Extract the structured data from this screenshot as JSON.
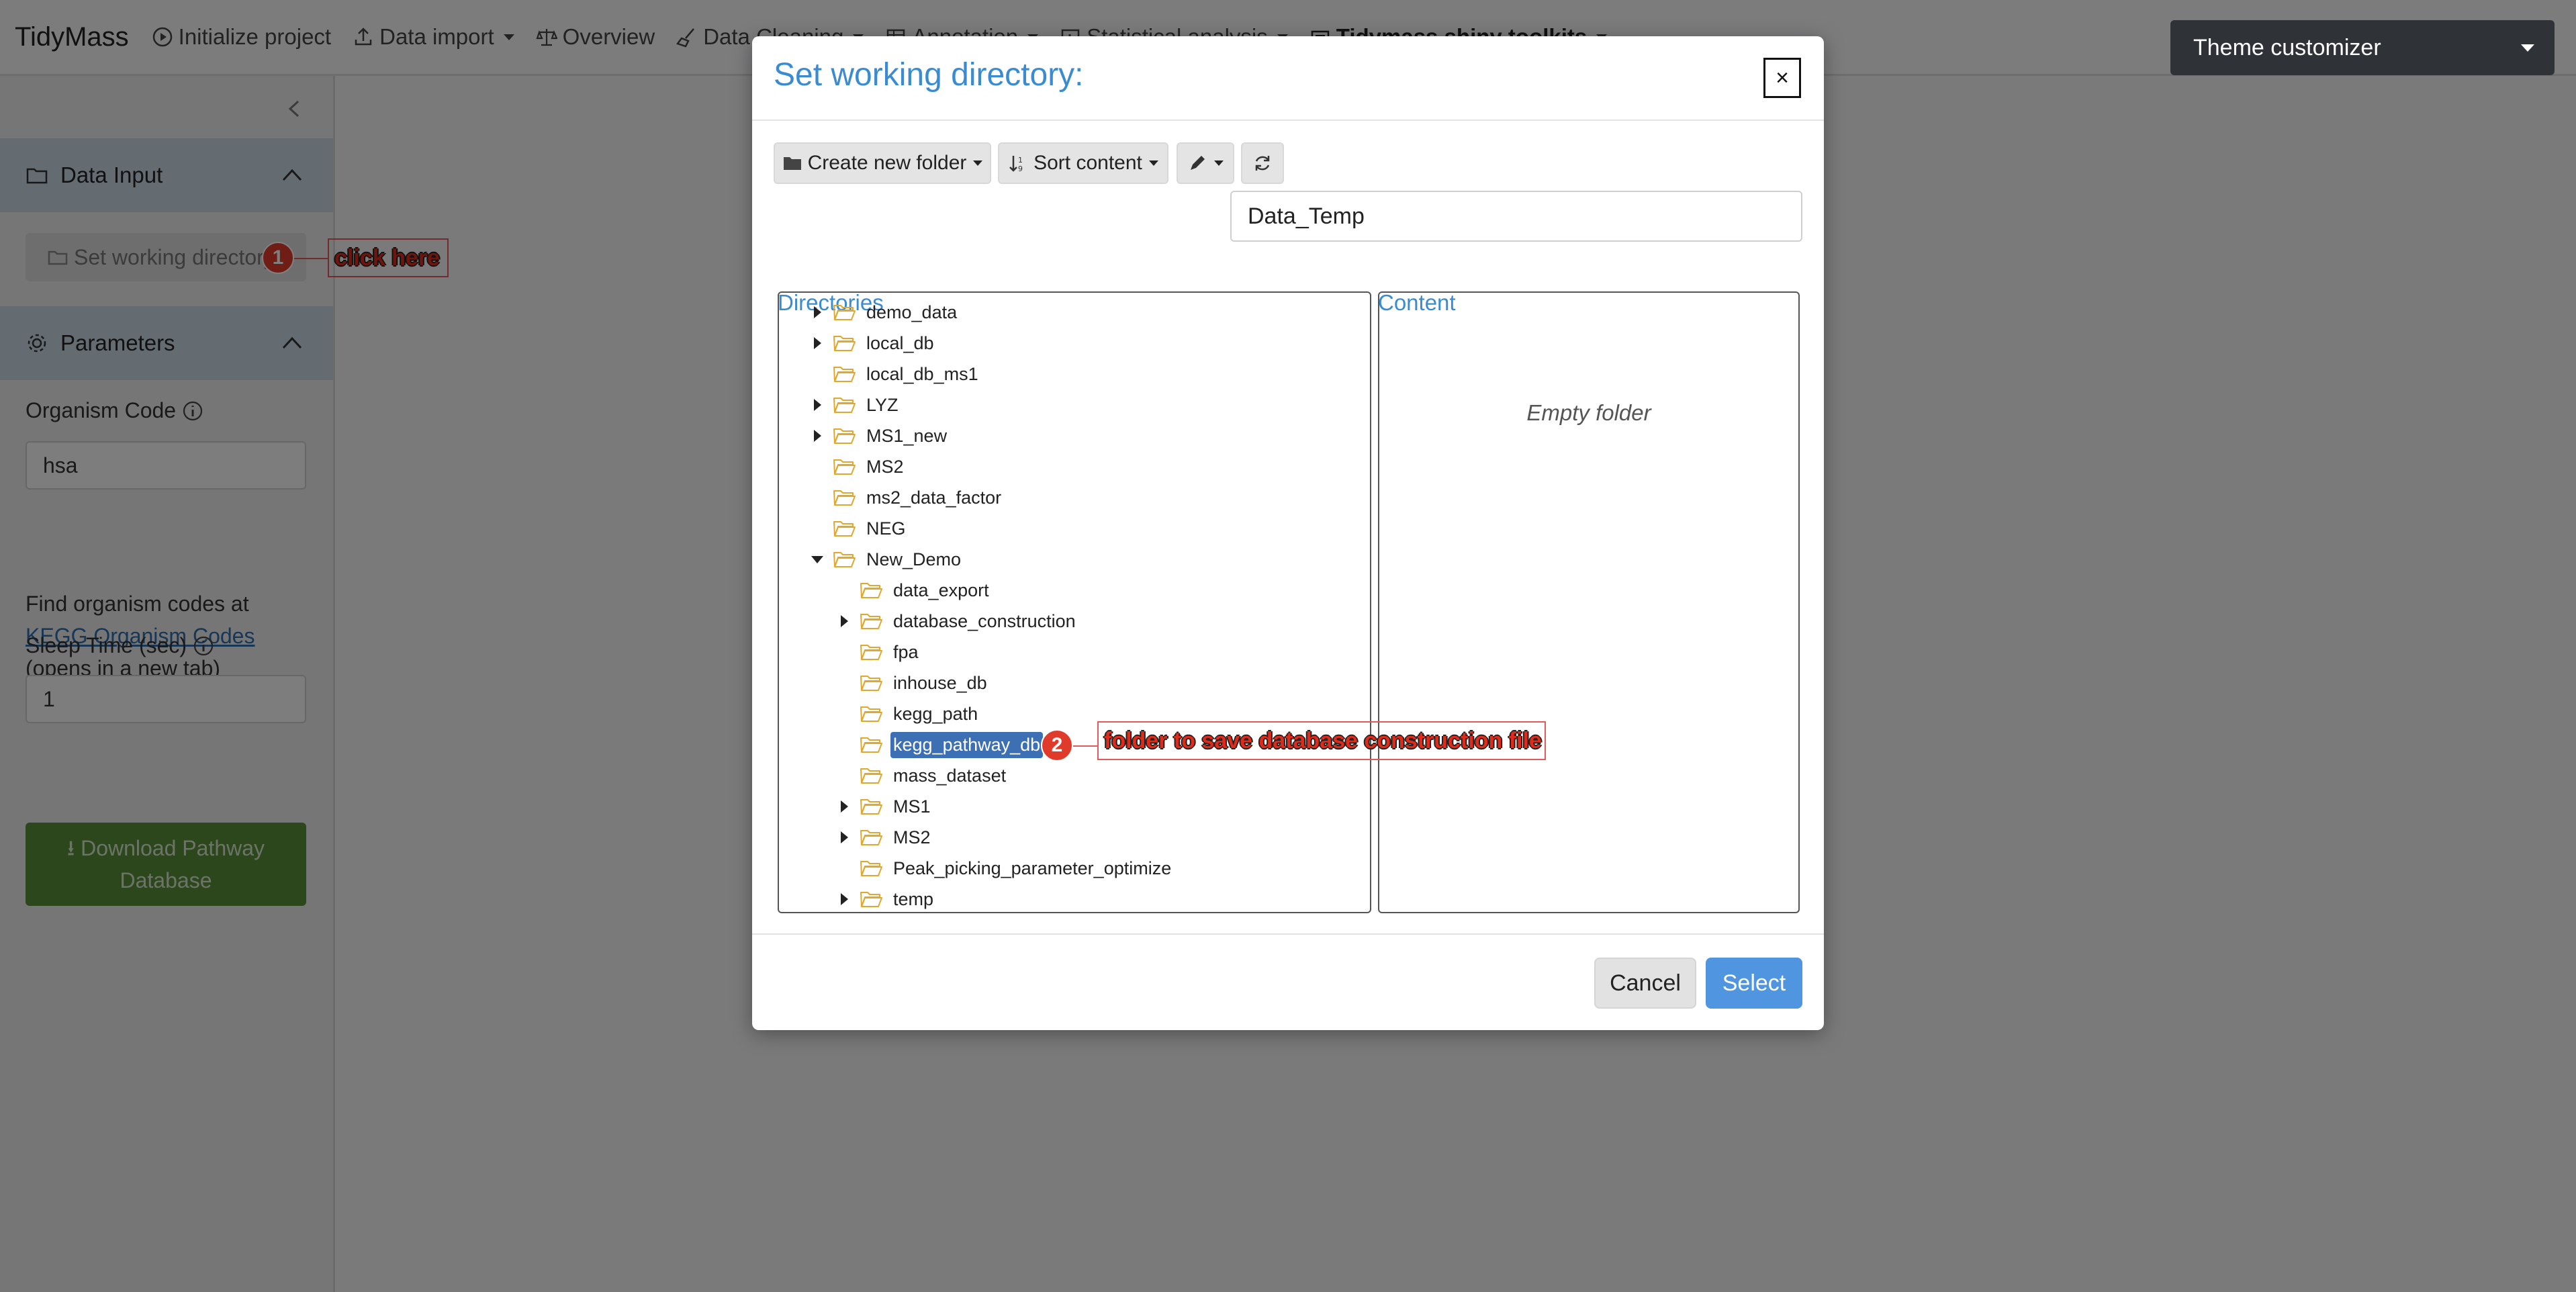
{
  "navbar": {
    "brand": "TidyMass",
    "items": [
      {
        "label": "Initialize project",
        "icon": "play-circle-icon",
        "dropdown": false
      },
      {
        "label": "Data import",
        "icon": "upload-icon",
        "dropdown": true
      },
      {
        "label": "Overview",
        "icon": "balance-scale-icon",
        "dropdown": false
      },
      {
        "label": "Data Cleaning",
        "icon": "broom-icon",
        "dropdown": true
      },
      {
        "label": "Annotation",
        "icon": "table-icon",
        "dropdown": true
      },
      {
        "label": "Statistical analysis",
        "icon": "chart-icon",
        "dropdown": true
      },
      {
        "label": "Tidymass shiny toolkits",
        "icon": "toolbox-icon",
        "dropdown": true
      }
    ]
  },
  "theme_customizer": {
    "label": "Theme customizer"
  },
  "sidebar": {
    "data_input": {
      "title": "Data Input",
      "set_wd_label": "Set working directory"
    },
    "parameters": {
      "title": "Parameters",
      "organism_label": "Organism Code",
      "organism_value": "hsa",
      "helper_prefix": "Find organism codes at",
      "helper_link": "KEGG Organism Codes",
      "helper_suffix": "(opens in a new tab)",
      "sleep_label": "Sleep Time (sec)",
      "sleep_value": "1",
      "download_label": "Download Pathway Database"
    }
  },
  "annotations": [
    {
      "number": "1",
      "text": "click here"
    },
    {
      "number": "2",
      "text": "folder to save database construction file"
    }
  ],
  "modal": {
    "title": "Set working directory:",
    "close_label": "×",
    "toolbar": {
      "create_folder": "Create new folder",
      "sort_content": "Sort content"
    },
    "path_value": "Data_Temp",
    "directories_label": "Directories",
    "content_label": "Content",
    "empty_text": "Empty folder",
    "tree": [
      {
        "name": "demo_data",
        "depth": 0,
        "expander": "collapsed"
      },
      {
        "name": "local_db",
        "depth": 0,
        "expander": "collapsed"
      },
      {
        "name": "local_db_ms1",
        "depth": 0,
        "expander": "none"
      },
      {
        "name": "LYZ",
        "depth": 0,
        "expander": "collapsed"
      },
      {
        "name": "MS1_new",
        "depth": 0,
        "expander": "collapsed"
      },
      {
        "name": "MS2",
        "depth": 0,
        "expander": "none"
      },
      {
        "name": "ms2_data_factor",
        "depth": 0,
        "expander": "none"
      },
      {
        "name": "NEG",
        "depth": 0,
        "expander": "none"
      },
      {
        "name": "New_Demo",
        "depth": 0,
        "expander": "expanded"
      },
      {
        "name": "data_export",
        "depth": 1,
        "expander": "none"
      },
      {
        "name": "database_construction",
        "depth": 1,
        "expander": "collapsed"
      },
      {
        "name": "fpa",
        "depth": 1,
        "expander": "none"
      },
      {
        "name": "inhouse_db",
        "depth": 1,
        "expander": "none"
      },
      {
        "name": "kegg_path",
        "depth": 1,
        "expander": "none"
      },
      {
        "name": "kegg_pathway_db",
        "depth": 1,
        "expander": "none",
        "selected": true
      },
      {
        "name": "mass_dataset",
        "depth": 1,
        "expander": "none"
      },
      {
        "name": "MS1",
        "depth": 1,
        "expander": "collapsed"
      },
      {
        "name": "MS2",
        "depth": 1,
        "expander": "collapsed"
      },
      {
        "name": "Peak_picking_parameter_optimize",
        "depth": 1,
        "expander": "none"
      },
      {
        "name": "temp",
        "depth": 1,
        "expander": "collapsed"
      }
    ],
    "cancel_label": "Cancel",
    "select_label": "Select"
  },
  "colors": {
    "accent": "#3b8bd0",
    "selected": "#3d6fb5",
    "download_button": "#5a8f3a",
    "folder": "#e0a82e",
    "badge": "#e03a2a"
  }
}
